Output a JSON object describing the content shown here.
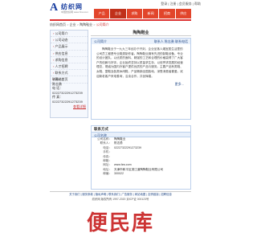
{
  "site": {
    "logo_mark": "A",
    "name": "纺织网",
    "sub": "中国纺织网 www.fzw.com"
  },
  "topbar": "登录 | 注册 | 会员服务 | 帮助",
  "nav": {
    "items": [
      "产品",
      "企业",
      "求购",
      "新闻",
      "招商",
      "供应"
    ],
    "active": 1
  },
  "breadcrumb": [
    "纺织网首页",
    "企业",
    "陶陶鞋业",
    "公司简介"
  ],
  "sidebar": {
    "items": [
      "公司简介",
      "公司动态",
      "产品展示",
      "供应信息",
      "求购信息",
      "人才招聘",
      "联系方式",
      "网站首页"
    ]
  },
  "side_contact": {
    "lines": [
      "联系人：",
      "陈志勇",
      "电 话：",
      "02227322291273239",
      "传 真：",
      "02227322291273239"
    ],
    "more": "查看详细"
  },
  "main": {
    "title": "陶陶鞋业"
  },
  "intro": {
    "title": "公司简介",
    "link": "联系人 陈志勇 联系电话",
    "text": "陶陶鞋业于一九九三年创办于开封，企业坐落人烟宜居生活里的公司员工都是专业鞋类制作者。陶陶鞋业拥有先进的制鞋设备，专业的设计团队，以优质的面料、精湛的工艺和合理的价格赢得了广大客户的信赖与好评。企业始终坚持以质量求生存、以信誉求发展的经营理念，竭诚为国内外客户提供优质的产品与服务。主要产品有男鞋、女鞋、童鞋及各类休闲鞋，产品畅销全国各地，深受消费者喜爱。欢迎新老客户来电垂询，洽谈合作，共创辉煌。",
    "more": "更多..."
  },
  "contact": {
    "title": "联系方式",
    "subtitle": "公司名称",
    "rows": [
      {
        "k": "公司名称：",
        "v": "陶陶鞋业"
      },
      {
        "k": "联系人：",
        "v": "陈志勇"
      },
      {
        "k": "电话：",
        "v": "02227322291273239"
      },
      {
        "k": "手机：",
        "v": ""
      },
      {
        "k": "传真：",
        "v": ""
      },
      {
        "k": "邮箱：",
        "v": ""
      },
      {
        "k": "网址：",
        "v": "www.fzw.com"
      },
      {
        "k": "地址：",
        "v": "天津市和平区滨江道陶陶鞋业有限公司"
      },
      {
        "k": "邮编：",
        "v": "300022"
      }
    ]
  },
  "footer": {
    "links": "关于我们 | 服务条款 | 隐私声明 | 联系我们 | 广告服务 | 网站地图 | 友情链接 | 招聘信息",
    "copyright": "纺织网 版权所有 1997-2020 京ICP证 000123号"
  },
  "watermark": "便民库"
}
